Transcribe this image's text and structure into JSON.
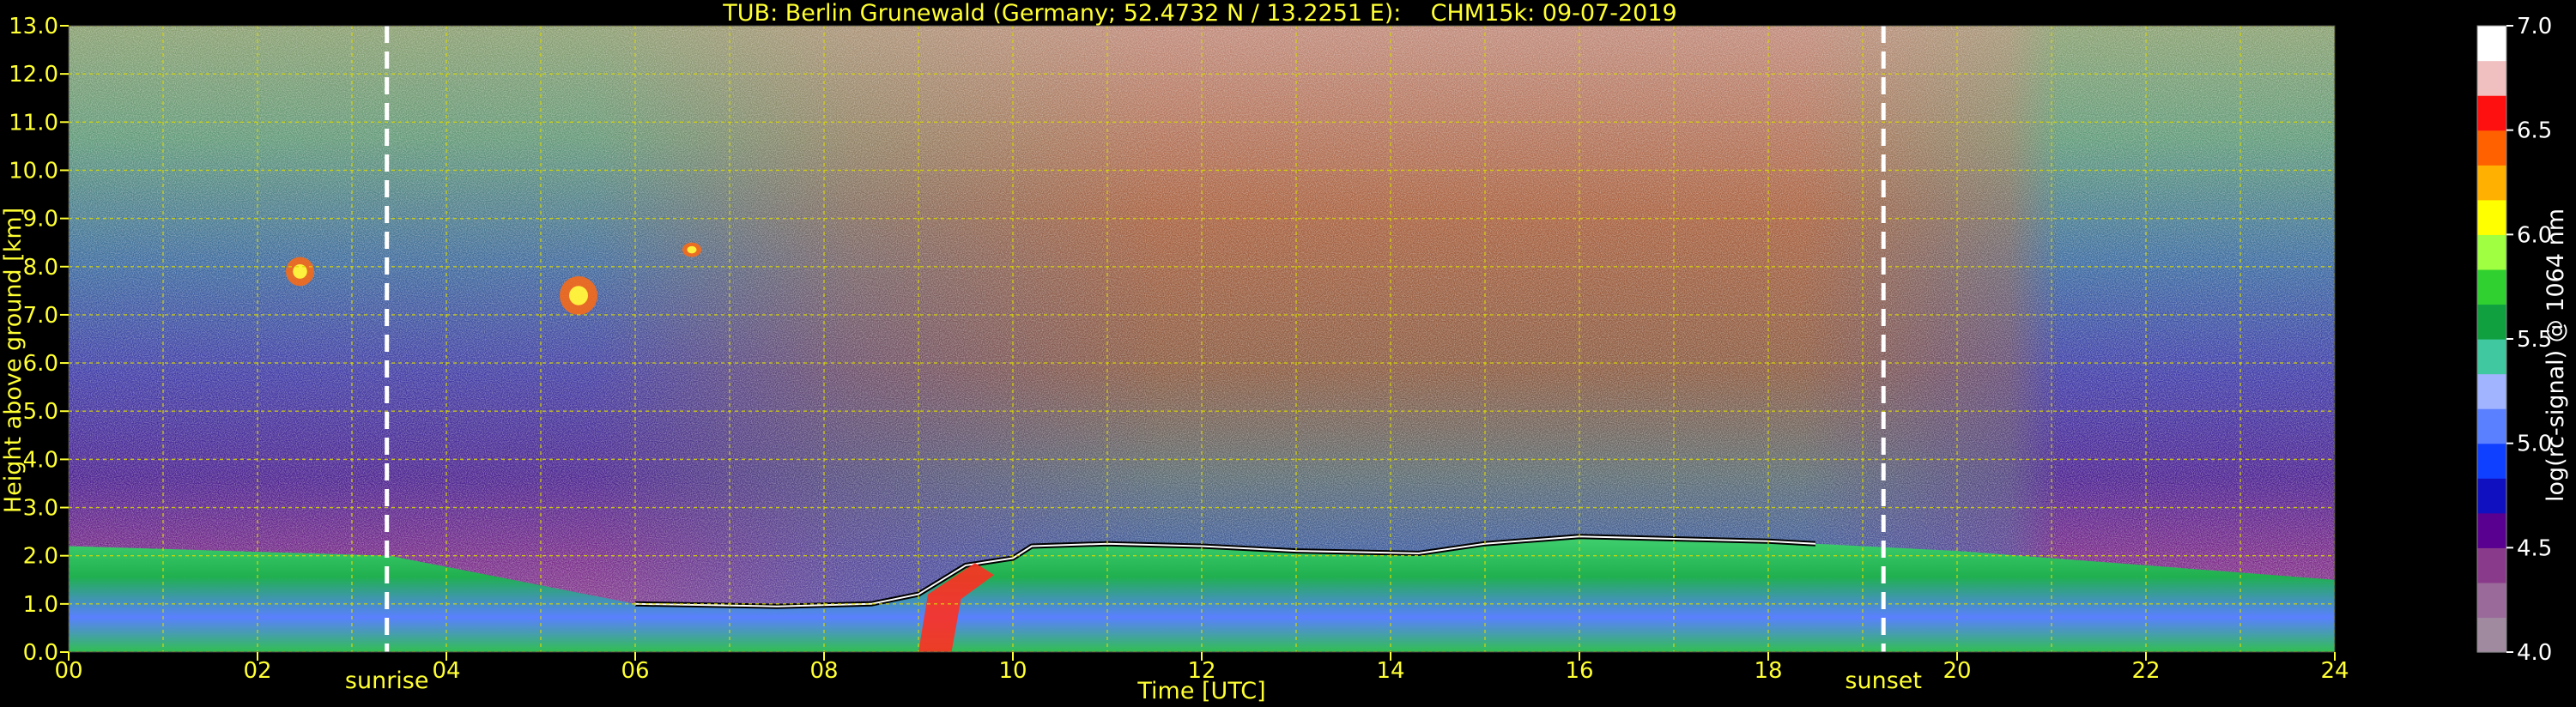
{
  "chart_data": {
    "type": "heatmap",
    "title": "TUB: Berlin Grunewald (Germany; 52.4732 N / 13.2251 E):    CHM15k: 09-07-2019",
    "xlabel": "Time [UTC]",
    "ylabel": "Height above ground [km]",
    "xlim": [
      0,
      24
    ],
    "ylim": [
      0,
      13
    ],
    "x_ticks": [
      "00",
      "02",
      "04",
      "06",
      "08",
      "10",
      "12",
      "14",
      "16",
      "18",
      "20",
      "22",
      "24"
    ],
    "y_ticks": [
      "0.0",
      "1.0",
      "2.0",
      "3.0",
      "4.0",
      "5.0",
      "6.0",
      "7.0",
      "8.0",
      "9.0",
      "10.0",
      "11.0",
      "12.0",
      "13.0"
    ],
    "y_tick_values": [
      0,
      1,
      2,
      3,
      4,
      5,
      6,
      7,
      8,
      9,
      10,
      11,
      12,
      13
    ],
    "grid": true,
    "colorbar": {
      "label": "log(rc-signal) @ 1064 nm",
      "range": [
        4.0,
        7.0
      ],
      "ticks": [
        "4.0",
        "4.5",
        "5.0",
        "5.5",
        "6.0",
        "6.5",
        "7.0"
      ],
      "tick_values": [
        4.0,
        4.5,
        5.0,
        5.5,
        6.0,
        6.5,
        7.0
      ],
      "colors": [
        "#a08aa0",
        "#9a6a9a",
        "#8a3a8a",
        "#5a0090",
        "#1010c0",
        "#1040ff",
        "#5a80ff",
        "#a0b4ff",
        "#40c8a0",
        "#10a040",
        "#30d030",
        "#a0ff40",
        "#ffff00",
        "#ffb000",
        "#ff6000",
        "#ff1010",
        "#f0c0c0",
        "#ffffff"
      ]
    },
    "markers": [
      {
        "label": "sunrise",
        "x": 3.37
      },
      {
        "label": "sunset",
        "x": 19.22
      }
    ],
    "boundary_layer_top_km": [
      [
        0,
        2.2
      ],
      [
        3.4,
        2.0
      ],
      [
        6,
        1.0
      ],
      [
        7.5,
        0.95
      ],
      [
        8.5,
        1.0
      ],
      [
        9.0,
        1.2
      ],
      [
        9.5,
        1.8
      ],
      [
        10,
        1.95
      ],
      [
        10.2,
        2.2
      ],
      [
        11,
        2.25
      ],
      [
        12,
        2.2
      ],
      [
        13,
        2.1
      ],
      [
        14.3,
        2.05
      ],
      [
        15,
        2.25
      ],
      [
        16,
        2.4
      ],
      [
        17,
        2.35
      ],
      [
        18,
        2.3
      ],
      [
        18.5,
        2.25
      ],
      [
        20,
        2.1
      ],
      [
        22,
        1.8
      ],
      [
        24,
        1.5
      ]
    ],
    "aerosol_layers": [
      {
        "x": [
          2.3,
          2.6
        ],
        "height_km": [
          7.6,
          8.2
        ]
      },
      {
        "x": [
          5.2,
          5.6
        ],
        "height_km": [
          7.0,
          7.8
        ]
      },
      {
        "x": [
          6.5,
          6.7
        ],
        "height_km": [
          8.2,
          8.5
        ]
      }
    ]
  }
}
